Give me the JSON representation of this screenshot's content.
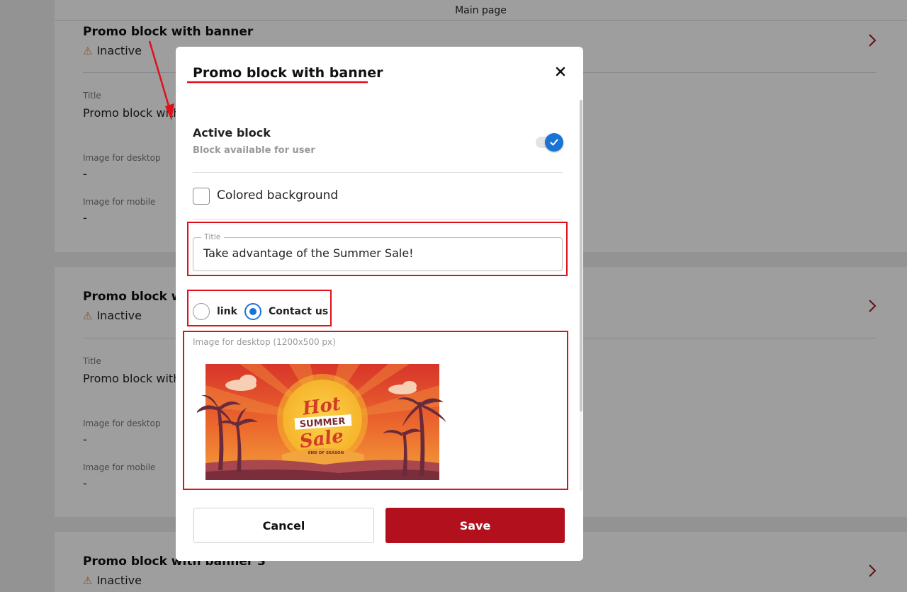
{
  "header": {
    "title": "Main page"
  },
  "cards": [
    {
      "title": "Promo block with banner",
      "status": "Inactive",
      "fields": [
        {
          "label": "Title",
          "value": "Promo block with"
        },
        {
          "label": "Image for desktop",
          "value": "-"
        },
        {
          "label": "Image for mobile",
          "value": "-"
        }
      ]
    },
    {
      "title": "Promo block wi",
      "status": "Inactive",
      "fields": [
        {
          "label": "Title",
          "value": "Promo block with"
        },
        {
          "label": "Image for desktop",
          "value": "-"
        },
        {
          "label": "Image for mobile",
          "value": "-"
        }
      ]
    },
    {
      "title": "Promo block with banner 3",
      "status": "Inactive",
      "fields": []
    }
  ],
  "modal": {
    "title": "Promo block with banner",
    "active_block": {
      "title": "Active block",
      "subtitle": "Block available for user",
      "enabled": true
    },
    "colored_background": {
      "label": "Colored background",
      "checked": false
    },
    "title_field": {
      "legend": "Title",
      "value": "Take advantage of the Summer Sale!"
    },
    "radio_options": [
      {
        "label": "link",
        "selected": false
      },
      {
        "label": "Contact us",
        "selected": true
      }
    ],
    "image_desktop": {
      "label": "Image for desktop (1200x500 px)",
      "banner_text": {
        "line1": "Hot",
        "line2": "SUMMER",
        "line3": "Sale",
        "line4": "END OF SEASON"
      }
    },
    "buttons": {
      "cancel": "Cancel",
      "save": "Save"
    }
  },
  "colors": {
    "accent_blue": "#1a73d6",
    "primary_red": "#b3101e",
    "annotation_red": "#e0101a",
    "warning_orange": "#d8843a"
  },
  "icons": {
    "close": "close-icon",
    "chevron": "chevron-right-icon",
    "warning": "warning-icon",
    "check": "check-icon"
  }
}
